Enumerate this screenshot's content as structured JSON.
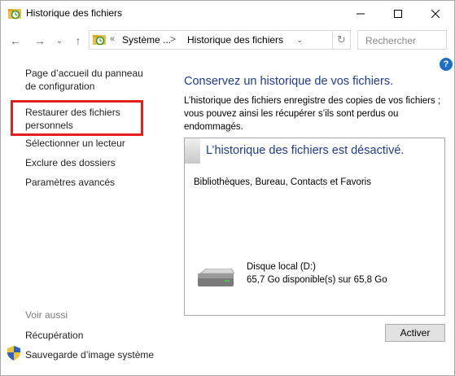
{
  "window": {
    "title": "Historique des fichiers",
    "minimize_symbol": "—",
    "maximize_symbol": "☐",
    "close_symbol": "✕"
  },
  "nav": {
    "back_symbol": "←",
    "forward_symbol": "→",
    "recent_symbol": "⌄",
    "up_symbol": "↑",
    "address": {
      "overflow": "«",
      "crumbs": [
        "Système ...",
        "Historique des fichiers"
      ],
      "separator": ">",
      "dropdown_symbol": "⌄",
      "refresh_symbol": "↻"
    },
    "search": {
      "placeholder": "Rechercher"
    }
  },
  "help_label": "?",
  "sidebar": {
    "links": [
      {
        "label": "Page d’accueil du panneau de configuration"
      },
      {
        "label": "Restaurer des fichiers personnels",
        "highlighted": true
      },
      {
        "label": "Sélectionner un lecteur"
      },
      {
        "label": "Exclure des dossiers"
      },
      {
        "label": "Paramètres avancés"
      }
    ],
    "see_also": {
      "heading": "Voir aussi",
      "links": [
        {
          "label": "Récupération"
        },
        {
          "label": "Sauvegarde d’image système",
          "icon": "shield-icon"
        }
      ]
    },
    "highlight_color": "#e1201d"
  },
  "main": {
    "heading": "Conservez un historique de vos fichiers.",
    "description": "L’historique des fichiers enregistre des copies de vos fichiers ; vous pouvez ainsi les récupérer s’ils sont perdus ou endommagés.",
    "status_panel": {
      "title": "L’historique des fichiers est désactivé.",
      "subtitle": "Bibliothèques, Bureau, Contacts et Favoris",
      "drive": {
        "name": "Disque local (D:)",
        "space": "65,7 Go disponible(s) sur 65,8 Go",
        "icon": "hard-drive-icon"
      }
    },
    "activate_button": "Activer"
  },
  "colors": {
    "heading_blue": "#1e3b8f",
    "help_blue": "#1c6fc6"
  }
}
